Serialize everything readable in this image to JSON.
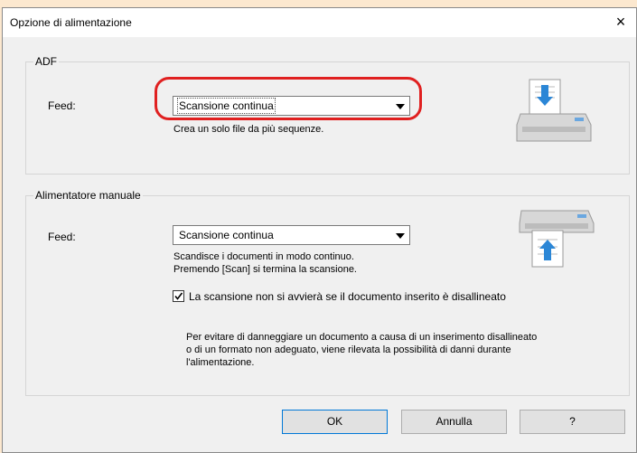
{
  "window": {
    "title": "Opzione di alimentazione",
    "close_icon": "×"
  },
  "adf": {
    "group_label": "ADF",
    "feed_label": "Feed:",
    "feed_value": "Scansione continua",
    "description": "Crea un solo file da più sequenze."
  },
  "manual": {
    "group_label": "Alimentatore manuale",
    "feed_label": "Feed:",
    "feed_value": "Scansione continua",
    "description_line1": "Scandisce i documenti in modo continuo.",
    "description_line2": "Premendo [Scan] si termina la scansione.",
    "checkbox_checked": true,
    "checkbox_label": "La scansione non si avvierà se il documento inserito è disallineato",
    "note_line1": "Per evitare di danneggiare un documento a causa di un inserimento disallineato",
    "note_line2": "o di un formato non adeguato, viene rilevata la possibilità di danni durante",
    "note_line3": "l'alimentazione."
  },
  "buttons": {
    "ok": "OK",
    "cancel": "Annulla",
    "help": "?"
  },
  "colors": {
    "highlight": "#e02020",
    "scanner_blue": "#2b86d6"
  }
}
